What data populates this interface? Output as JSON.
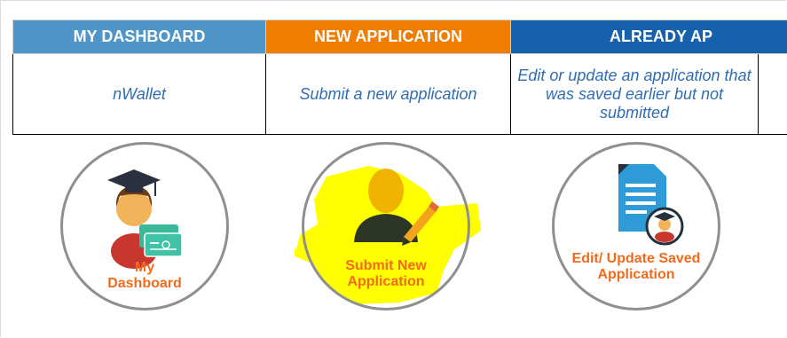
{
  "menu": {
    "headers": [
      "MY DASHBOARD",
      "NEW APPLICATION",
      "ALREADY AP"
    ],
    "descriptions": [
      "nWallet",
      "Submit a new application",
      "Edit or update an application that was saved earlier but not submitted"
    ]
  },
  "tiles": {
    "dashboard": {
      "line1": "My",
      "line2": "Dashboard",
      "icon": "graduate-wallet-icon"
    },
    "new": {
      "line1": "Submit New",
      "line2": "Application",
      "icon": "user-pencil-icon"
    },
    "saved": {
      "line1": "Edit/ Update Saved",
      "line2": "Application",
      "icon": "document-graduate-icon"
    }
  },
  "colors": {
    "dashboard_header": "#4f96c8",
    "new_header": "#ef7d00",
    "saved_header": "#1561ac",
    "description_text": "#2e6db4",
    "caption_text": "#f26b1d",
    "highlight": "#ffff00"
  }
}
